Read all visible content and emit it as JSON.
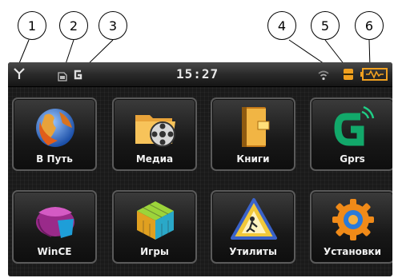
{
  "callouts": [
    "1",
    "2",
    "3",
    "4",
    "5",
    "6"
  ],
  "status_bar": {
    "time": "15:27",
    "icons": [
      "antenna-icon",
      "sd-card-icon",
      "gprs-g-icon",
      "wifi-icon",
      "volume-icon",
      "battery-icon"
    ]
  },
  "menu": {
    "tiles": [
      {
        "label": "В Путь",
        "icon": "globe-navigation-icon"
      },
      {
        "label": "Медиа",
        "icon": "media-folder-icon"
      },
      {
        "label": "Книги",
        "icon": "book-icon"
      },
      {
        "label": "Gprs",
        "icon": "gprs-icon"
      },
      {
        "label": "WinCE",
        "icon": "wince-icon"
      },
      {
        "label": "Игры",
        "icon": "cube-games-icon"
      },
      {
        "label": "Утилиты",
        "icon": "utilities-warning-icon"
      },
      {
        "label": "Установки",
        "icon": "settings-gear-icon"
      }
    ]
  },
  "colors": {
    "accent_orange": "#f0a020",
    "screen_bg": "#1a1a1a"
  }
}
